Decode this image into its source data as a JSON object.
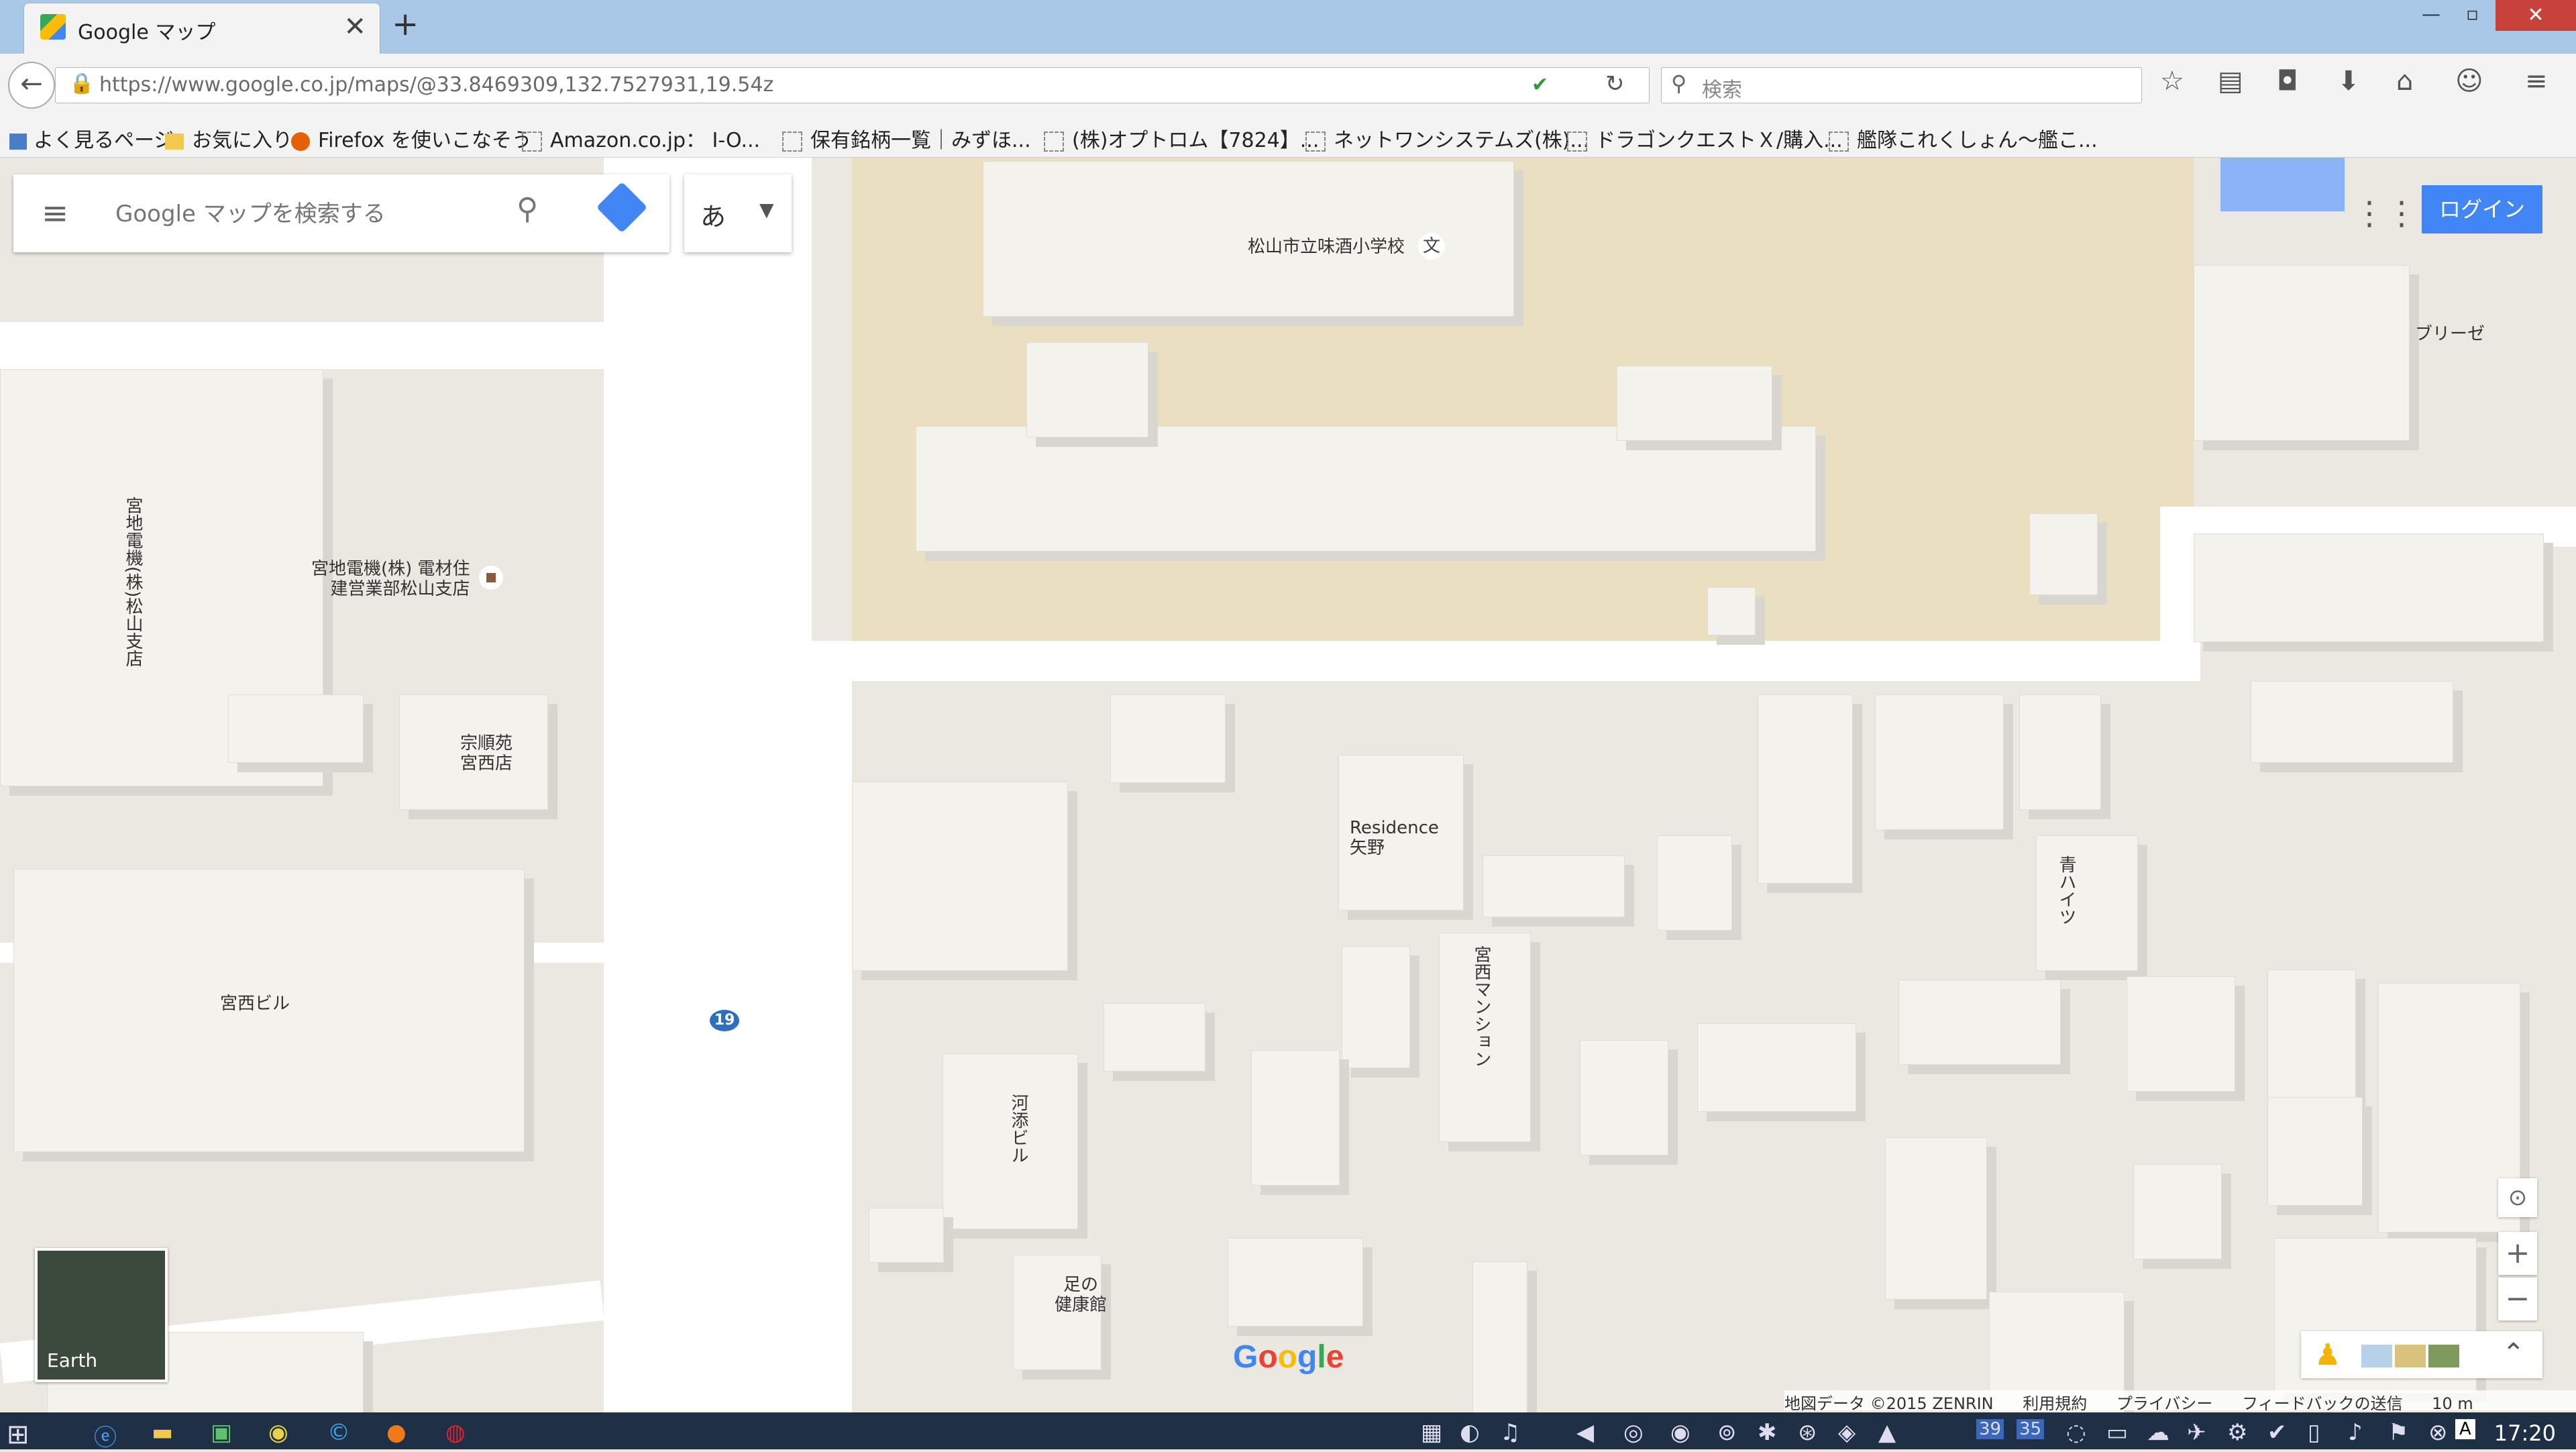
{
  "browser": {
    "tab_title": "Google マップ",
    "url": "https://www.google.co.jp/maps/@33.8469309,132.7527931,19.54z",
    "search_placeholder": "検索",
    "new_tab_label": "+",
    "close_label": "✕"
  },
  "bookmarks": [
    "よく見るページ",
    "お気に入り",
    "Firefox を使いこなそう",
    "Amazon.co.jp： I-O...",
    "保有銘柄一覧｜みずほ...",
    "(株)オプトロム【7824】...",
    "ネットワンシステムズ(株)...",
    "ドラゴンクエストＸ/購入...",
    "艦隊これくしょん〜艦こ..."
  ],
  "maps": {
    "search_placeholder": "Google マップを検索する",
    "ime_label": "あ",
    "login_label": "ログイン",
    "earth_label": "Earth",
    "logo": "Google",
    "route_badge": "19",
    "labels": {
      "school": "松山市立味酒小学校",
      "school_icon": "文",
      "miyaji_vertical": "宮地電機(株)松山支店",
      "miyaji": "宮地電機(株) 電材住\n建営業部松山支店",
      "sojuen": "宗順苑\n宮西店",
      "miyanishi_bldg": "宮西ビル",
      "residence": "Residence\n矢野",
      "miyanishi_mansion": "宮西マンション",
      "kawazoe_bldg": "河添ビル",
      "ashi": "足の\n健康館",
      "breeze": "ブリーゼ",
      "haitsu": "青ハイツ"
    },
    "footer": {
      "map_data": "地図データ ©2015 ZENRIN",
      "terms": "利用規約",
      "privacy": "プライバシー",
      "feedback": "フィードバックの送信",
      "scale": "10 m"
    }
  },
  "taskbar": {
    "clock": "17:20",
    "badges": [
      "39",
      "35"
    ]
  }
}
